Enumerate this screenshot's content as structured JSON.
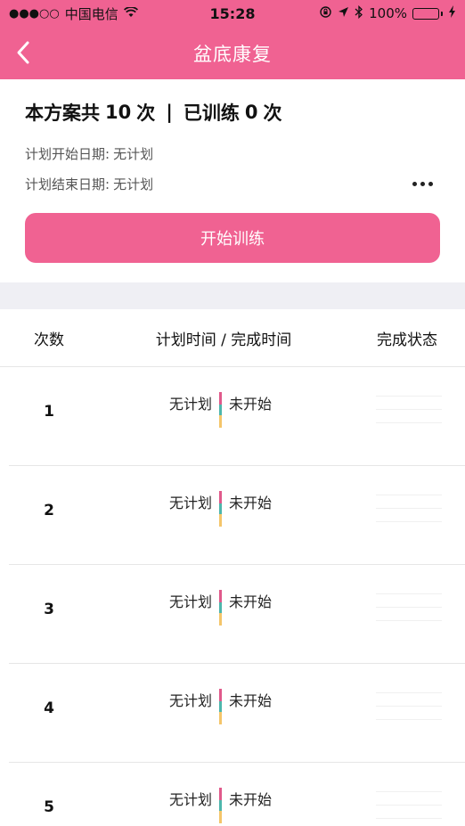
{
  "statusbar": {
    "signal": "●●●○○",
    "carrier": "中国电信",
    "time": "15:28",
    "battery_percent": "100%"
  },
  "navbar": {
    "title": "盆底康复"
  },
  "summary": {
    "plan_prefix": "本方案共",
    "plan_count": "10",
    "plan_suffix": "次",
    "separator": "|",
    "trained_prefix": "已训练",
    "trained_count": "0",
    "trained_suffix": "次",
    "start_date_label": "计划开始日期:",
    "start_date_value": "无计划",
    "end_date_label": "计划结束日期:",
    "end_date_value": "无计划",
    "start_button": "开始训练"
  },
  "table": {
    "headers": {
      "count": "次数",
      "time": "计划时间 / 完成时间",
      "status": "完成状态"
    },
    "rows": [
      {
        "num": "1",
        "plan": "无计划",
        "state": "未开始"
      },
      {
        "num": "2",
        "plan": "无计划",
        "state": "未开始"
      },
      {
        "num": "3",
        "plan": "无计划",
        "state": "未开始"
      },
      {
        "num": "4",
        "plan": "无计划",
        "state": "未开始"
      },
      {
        "num": "5",
        "plan": "无计划",
        "state": "未开始"
      }
    ]
  },
  "colors": {
    "brand": "#f06292",
    "battery": "#2ecc40"
  }
}
